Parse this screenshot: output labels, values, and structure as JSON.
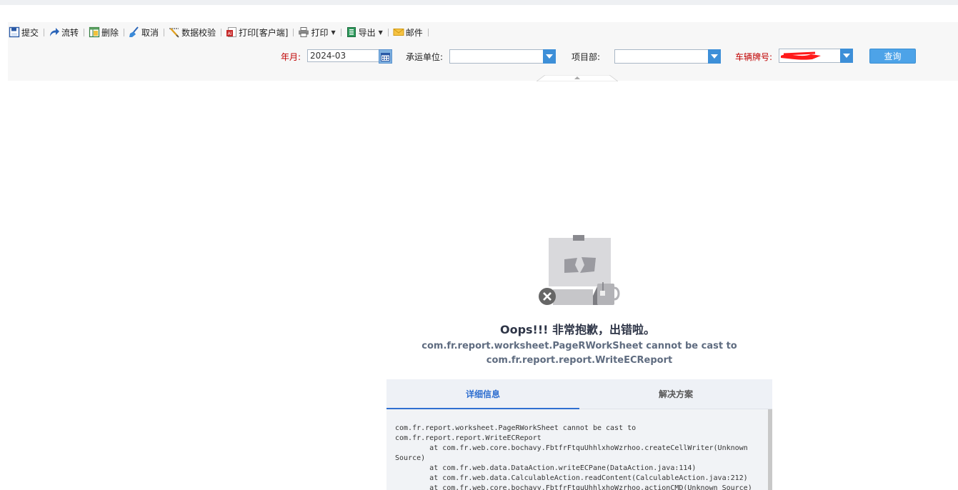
{
  "toolbar": {
    "submit": "提交",
    "transfer": "流转",
    "delete": "删除",
    "cancel": "取消",
    "validate": "数据校验",
    "print_client": "打印[客户端]",
    "print": "打印",
    "export": "导出",
    "mail": "邮件"
  },
  "params": {
    "year_month_label": "年月:",
    "year_month_value": "2024-03",
    "carrier_label": "承运单位:",
    "carrier_value": "",
    "project_label": "项目部:",
    "project_value": "",
    "plate_label": "车辆牌号:",
    "plate_value": "",
    "search_label": "查询"
  },
  "error": {
    "title": "Oops!!! 非常抱歉，出错啦。",
    "message": "com.fr.report.worksheet.PageRWorkSheet cannot be cast to com.fr.report.report.WriteECReport",
    "tab_details": "详细信息",
    "tab_solution": "解决方案",
    "stack_trace": "com.fr.report.worksheet.PageRWorkSheet cannot be cast to\ncom.fr.report.report.WriteECReport\n        at com.fr.web.core.bochavy.FbtfrFtquUhhlxhoWzrhoo.createCellWriter(Unknown\nSource)\n        at com.fr.web.data.DataAction.writeECPane(DataAction.java:114)\n        at com.fr.web.data.CalculableAction.readContent(CalculableAction.java:212)\n        at com.fr.web.core.bochavy.FbtfrFtquUhhlxhoWzrhoo.actionCMD(Unknown Source)"
  },
  "colors": {
    "required_label": "#c00000",
    "accent_blue": "#2f6fd0",
    "query_button": "#4da3e8"
  },
  "icons": [
    "save-icon",
    "forward-arrow-icon",
    "table-icon",
    "broom-icon",
    "validate-icon",
    "pdf-print-icon",
    "printer-icon",
    "excel-export-icon",
    "envelope-icon",
    "calendar-icon",
    "dropdown-arrow-icon",
    "error-illustration"
  ]
}
